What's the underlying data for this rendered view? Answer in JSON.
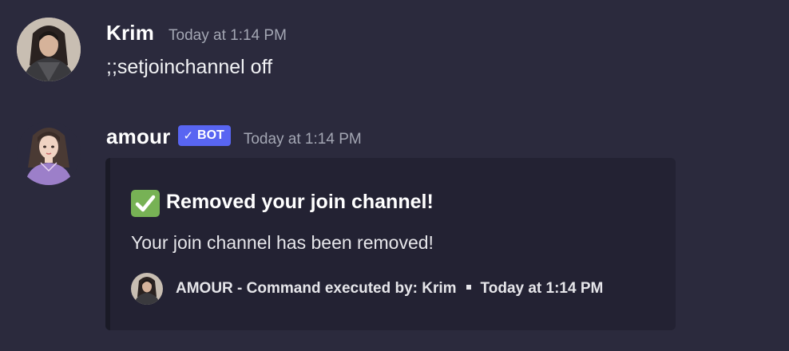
{
  "messages": [
    {
      "username": "Krim",
      "timestamp": "Today at 1:14 PM",
      "content": ";;setjoinchannel off",
      "avatar_icon": "user-avatar-icon"
    },
    {
      "username": "amour",
      "badge": "BOT",
      "badge_check": "✓",
      "timestamp": "Today at 1:14 PM",
      "avatar_icon": "bot-avatar-icon",
      "embed": {
        "title": "Removed your join channel!",
        "title_icon": "white-check-mark-icon",
        "description": "Your join channel has been removed!",
        "footer_text": "AMOUR - Command executed by: Krim",
        "footer_time": "Today at 1:14 PM"
      }
    }
  ],
  "colors": {
    "background": "#2b2a3d",
    "embed_background": "#232233",
    "bot_badge": "#5865f2",
    "check_emoji": "#77b255",
    "timestamp": "#a3a6b3"
  }
}
